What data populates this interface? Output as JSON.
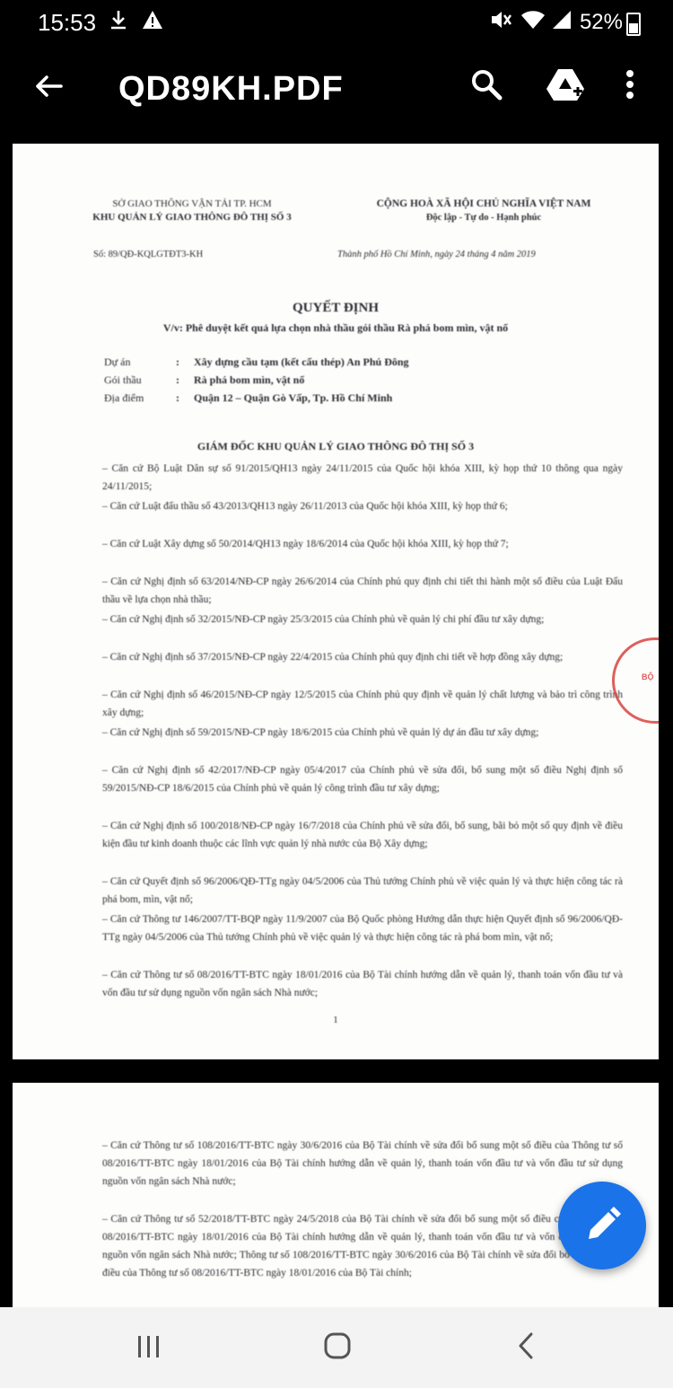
{
  "status_bar": {
    "time": "15:53",
    "battery": "52%",
    "icons": [
      "download-icon",
      "warning-icon",
      "mute-icon",
      "wifi-icon",
      "signal-icon"
    ]
  },
  "app_bar": {
    "title": "QD89KH.PDF",
    "icons": [
      "back-arrow-icon",
      "search-icon",
      "drive-icon",
      "more-vert-icon"
    ]
  },
  "page1": {
    "header_left": [
      "SỞ GIAO THÔNG VẬN TẢI TP. HCM",
      "KHU QUẢN LÝ GIAO THÔNG ĐÔ THỊ SỐ 3"
    ],
    "header_right": [
      "CỘNG HOÀ XÃ HỘI CHỦ NGHĨA VIỆT NAM",
      "Độc lập - Tự do - Hạnh phúc"
    ],
    "ref_number": "Số: 89/QĐ-KQLGTĐT3-KH",
    "ref_date": "Thành phố Hồ Chí Minh, ngày 24 tháng 4 năm 2019",
    "title": "QUYẾT ĐỊNH",
    "subject": "V/v: Phê duyệt kết quả lựa chọn nhà thầu gói thầu Rà phá bom mìn, vật nổ",
    "info": [
      {
        "label": "Dự án",
        "value": "Xây dựng cầu tạm (kết cấu thép) An Phú Đông"
      },
      {
        "label": "Gói thầu",
        "value": "Rà phá bom mìn, vật nổ"
      },
      {
        "label": "Địa điểm",
        "value": "Quận 12 – Quận Gò Vấp, Tp. Hồ Chí Minh"
      }
    ],
    "director_heading": "GIÁM ĐỐC KHU QUẢN LÝ GIAO THÔNG ĐÔ THỊ SỐ 3",
    "clauses": [
      "– Căn cứ Bộ Luật Dân sự số 91/2015/QH13 ngày 24/11/2015 của Quốc hội khóa XIII, kỳ họp thứ 10 thông qua ngày 24/11/2015;",
      "– Căn cứ Luật đấu thầu số 43/2013/QH13 ngày 26/11/2013 của Quốc hội khóa XIII, kỳ họp thứ 6;",
      "– Căn cứ Luật Xây dựng số 50/2014/QH13 ngày 18/6/2014 của Quốc hội khóa XIII, kỳ họp thứ 7;",
      "– Căn cứ Nghị định số 63/2014/NĐ-CP ngày 26/6/2014 của Chính phủ quy định chi tiết thi hành một số điều của Luật Đấu thầu về lựa chọn nhà thầu;",
      "– Căn cứ Nghị định số 32/2015/NĐ-CP ngày 25/3/2015 của Chính phủ về quản lý chi phí đầu tư xây dựng;",
      "– Căn cứ Nghị định số 37/2015/NĐ-CP ngày 22/4/2015 của Chính phủ quy định chi tiết về hợp đồng xây dựng;",
      "– Căn cứ Nghị định số 46/2015/NĐ-CP ngày 12/5/2015 của Chính phủ quy định về quản lý chất lượng và bảo trì công trình xây dựng;",
      "– Căn cứ Nghị định số 59/2015/NĐ-CP ngày 18/6/2015 của Chính phủ về quản lý dự án đầu tư xây dựng;",
      "– Căn cứ Nghị định số 42/2017/NĐ-CP ngày 05/4/2017 của Chính phủ về sửa đổi, bổ sung một số điều Nghị định số 59/2015/NĐ-CP 18/6/2015 của Chính phủ về quản lý công trình đầu tư xây dựng;",
      "– Căn cứ Nghị định số 100/2018/NĐ-CP ngày 16/7/2018 của Chính phủ về sửa đổi, bổ sung, bãi bỏ một số quy định về điều kiện đầu tư kinh doanh thuộc các lĩnh vực quản lý nhà nước của Bộ Xây dựng;",
      "– Căn cứ Quyết định số 96/2006/QĐ-TTg ngày 04/5/2006 của Thủ tướng Chính phủ về việc quản lý và thực hiện công tác rà phá bom, mìn, vật nổ;",
      "– Căn cứ Thông tư 146/2007/TT-BQP ngày 11/9/2007 của Bộ Quốc phòng Hướng dẫn thực hiện Quyết định số 96/2006/QĐ-TTg ngày 04/5/2006 của Thủ tướng Chính phủ về việc quản lý và thực hiện công tác rà phá bom mìn, vật nổ;",
      "– Căn cứ Thông tư số 08/2016/TT-BTC ngày 18/01/2016 của Bộ Tài chính hướng dẫn về quản lý, thanh toán vốn đầu tư và vốn đầu tư sử dụng nguồn vốn ngân sách Nhà nước;"
    ],
    "page_number": "1",
    "stamp_text": "BỘ"
  },
  "page2": {
    "clauses": [
      "– Căn cứ Thông tư số 108/2016/TT-BTC ngày 30/6/2016 của Bộ Tài chính về sửa đổi bổ sung một số điều của Thông tư số 08/2016/TT-BTC ngày 18/01/2016 của Bộ Tài chính hướng dẫn về quản lý, thanh toán vốn đầu tư và vốn đầu tư sử dụng nguồn vốn ngân sách Nhà nước;",
      "– Căn cứ Thông tư số 52/2018/TT-BTC ngày 24/5/2018 của Bộ Tài chính về sửa đổi bổ sung một số điều của Thông tư số 08/2016/TT-BTC ngày 18/01/2016 của Bộ Tài chính hướng dẫn về quản lý, thanh toán vốn đầu tư và vốn đầu tư sử dụng nguồn vốn ngân sách Nhà nước; Thông tư số 108/2016/TT-BTC ngày 30/6/2016 của Bộ Tài chính về sửa đổi bổ sung một số điều của Thông tư số 08/2016/TT-BTC ngày 18/01/2016 của Bộ Tài chính;"
    ]
  },
  "fab": {
    "icon": "edit-pencil-icon",
    "color": "#1a73e8"
  },
  "nav_bar": {
    "icons": [
      "recent-apps-icon",
      "home-icon",
      "back-icon"
    ]
  }
}
